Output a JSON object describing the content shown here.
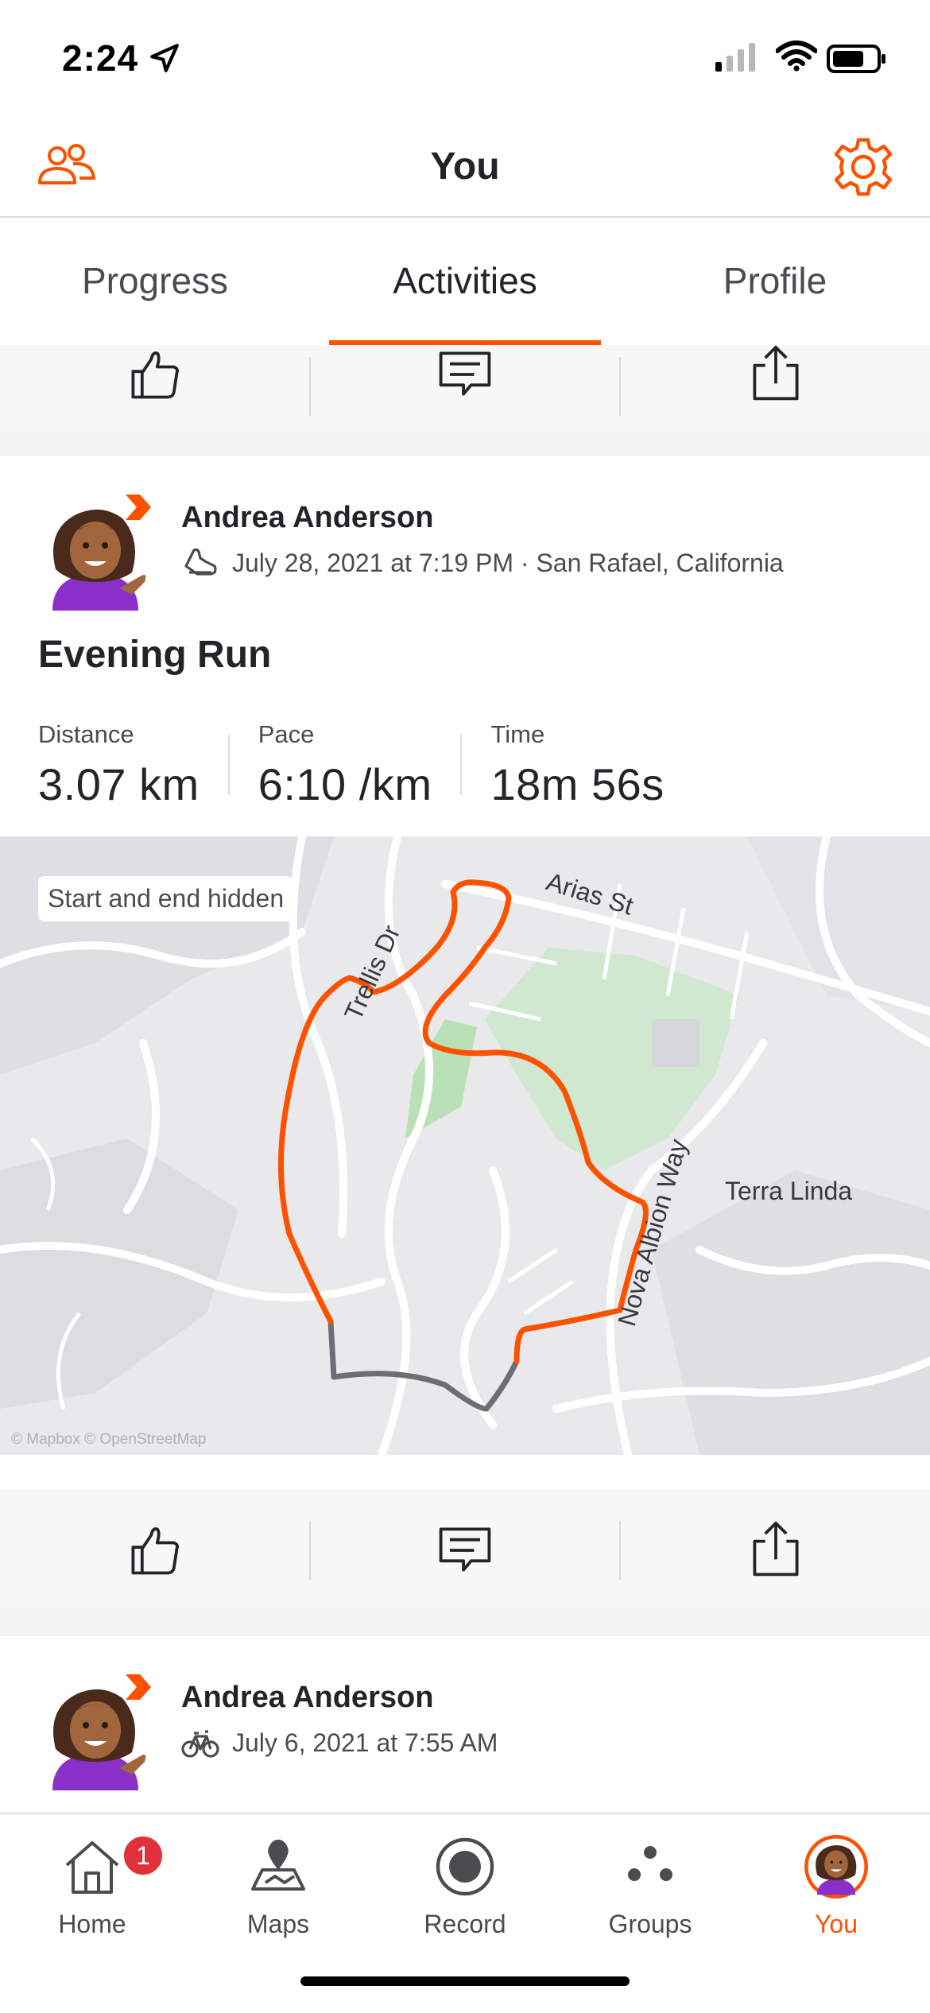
{
  "status_bar": {
    "time": "2:24"
  },
  "header": {
    "title": "You"
  },
  "tabs": [
    {
      "label": "Progress"
    },
    {
      "label": "Activities"
    },
    {
      "label": "Profile"
    }
  ],
  "activities": [
    {
      "athlete": "Andrea Anderson",
      "meta": "July 28, 2021 at 7:19 PM · San Rafael, California",
      "sport_icon": "shoe-icon",
      "title": "Evening Run",
      "stats": [
        {
          "label": "Distance",
          "value": "3.07 km"
        },
        {
          "label": "Pace",
          "value": "6:10 /km"
        },
        {
          "label": "Time",
          "value": "18m 56s"
        }
      ],
      "map": {
        "privacy_chip": "Start and end hidden",
        "labels": {
          "arias": "Arias St",
          "trellis": "Trellis Dr",
          "nova": "Nova Albion Way",
          "terra": "Terra Linda"
        },
        "attribution": "© Mapbox © OpenStreetMap",
        "route_color": "#fc5200",
        "hidden_route_color": "#6d6d78"
      }
    },
    {
      "athlete": "Andrea Anderson",
      "meta": "July 6, 2021 at 7:55 AM",
      "sport_icon": "bike-icon"
    }
  ],
  "tabbar": {
    "items": [
      {
        "label": "Home",
        "icon": "home-icon",
        "badge": "1"
      },
      {
        "label": "Maps",
        "icon": "maps-icon"
      },
      {
        "label": "Record",
        "icon": "record-icon"
      },
      {
        "label": "Groups",
        "icon": "groups-icon"
      },
      {
        "label": "You",
        "icon": "avatar"
      }
    ]
  },
  "colors": {
    "accent": "#fc5200",
    "text": "#242428",
    "badge": "#e0303a"
  }
}
